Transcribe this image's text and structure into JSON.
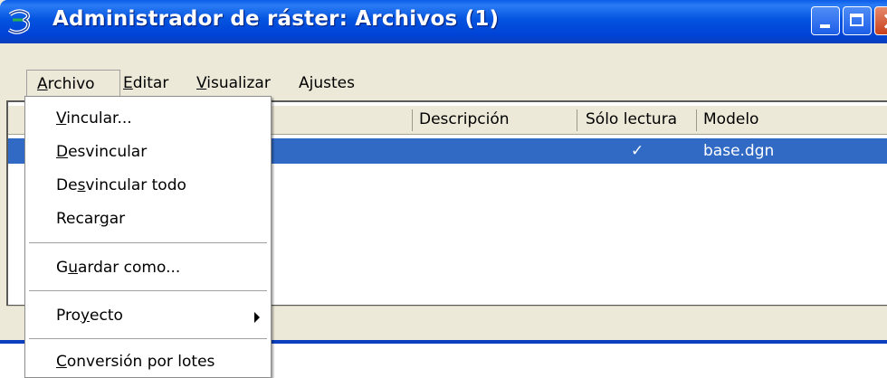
{
  "window": {
    "title": "Administrador de ráster: Archivos (1)",
    "accent_color": "#0a5be8",
    "selection_color": "#316ac5"
  },
  "menubar": {
    "items": [
      {
        "label": "Archivo",
        "mnemonic_index": 0
      },
      {
        "label": "Editar",
        "mnemonic_index": 0
      },
      {
        "label": "Visualizar",
        "mnemonic_index": 0
      },
      {
        "label": "Ajustes",
        "mnemonic_index": 1
      }
    ]
  },
  "table": {
    "columns": [
      "Descripción",
      "Sólo lectura",
      "Modelo"
    ],
    "rows": [
      {
        "descripcion": "",
        "solo_lectura": "✓",
        "modelo": "base.dgn",
        "selected": true
      }
    ]
  },
  "archivo_menu": {
    "items": [
      {
        "label": "Vincular...",
        "mnemonic_index": 0
      },
      {
        "label": "Desvincular",
        "mnemonic_index": 0
      },
      {
        "label": "Desvincular todo",
        "mnemonic_index": 2
      },
      {
        "label": "Recargar",
        "mnemonic_index": 5
      },
      {
        "label": "Guardar como...",
        "mnemonic_index": 1
      },
      {
        "label": "Proyecto",
        "mnemonic_index": 3,
        "submenu": true
      },
      {
        "label": "Conversión por lotes",
        "mnemonic_index": 0
      }
    ]
  }
}
